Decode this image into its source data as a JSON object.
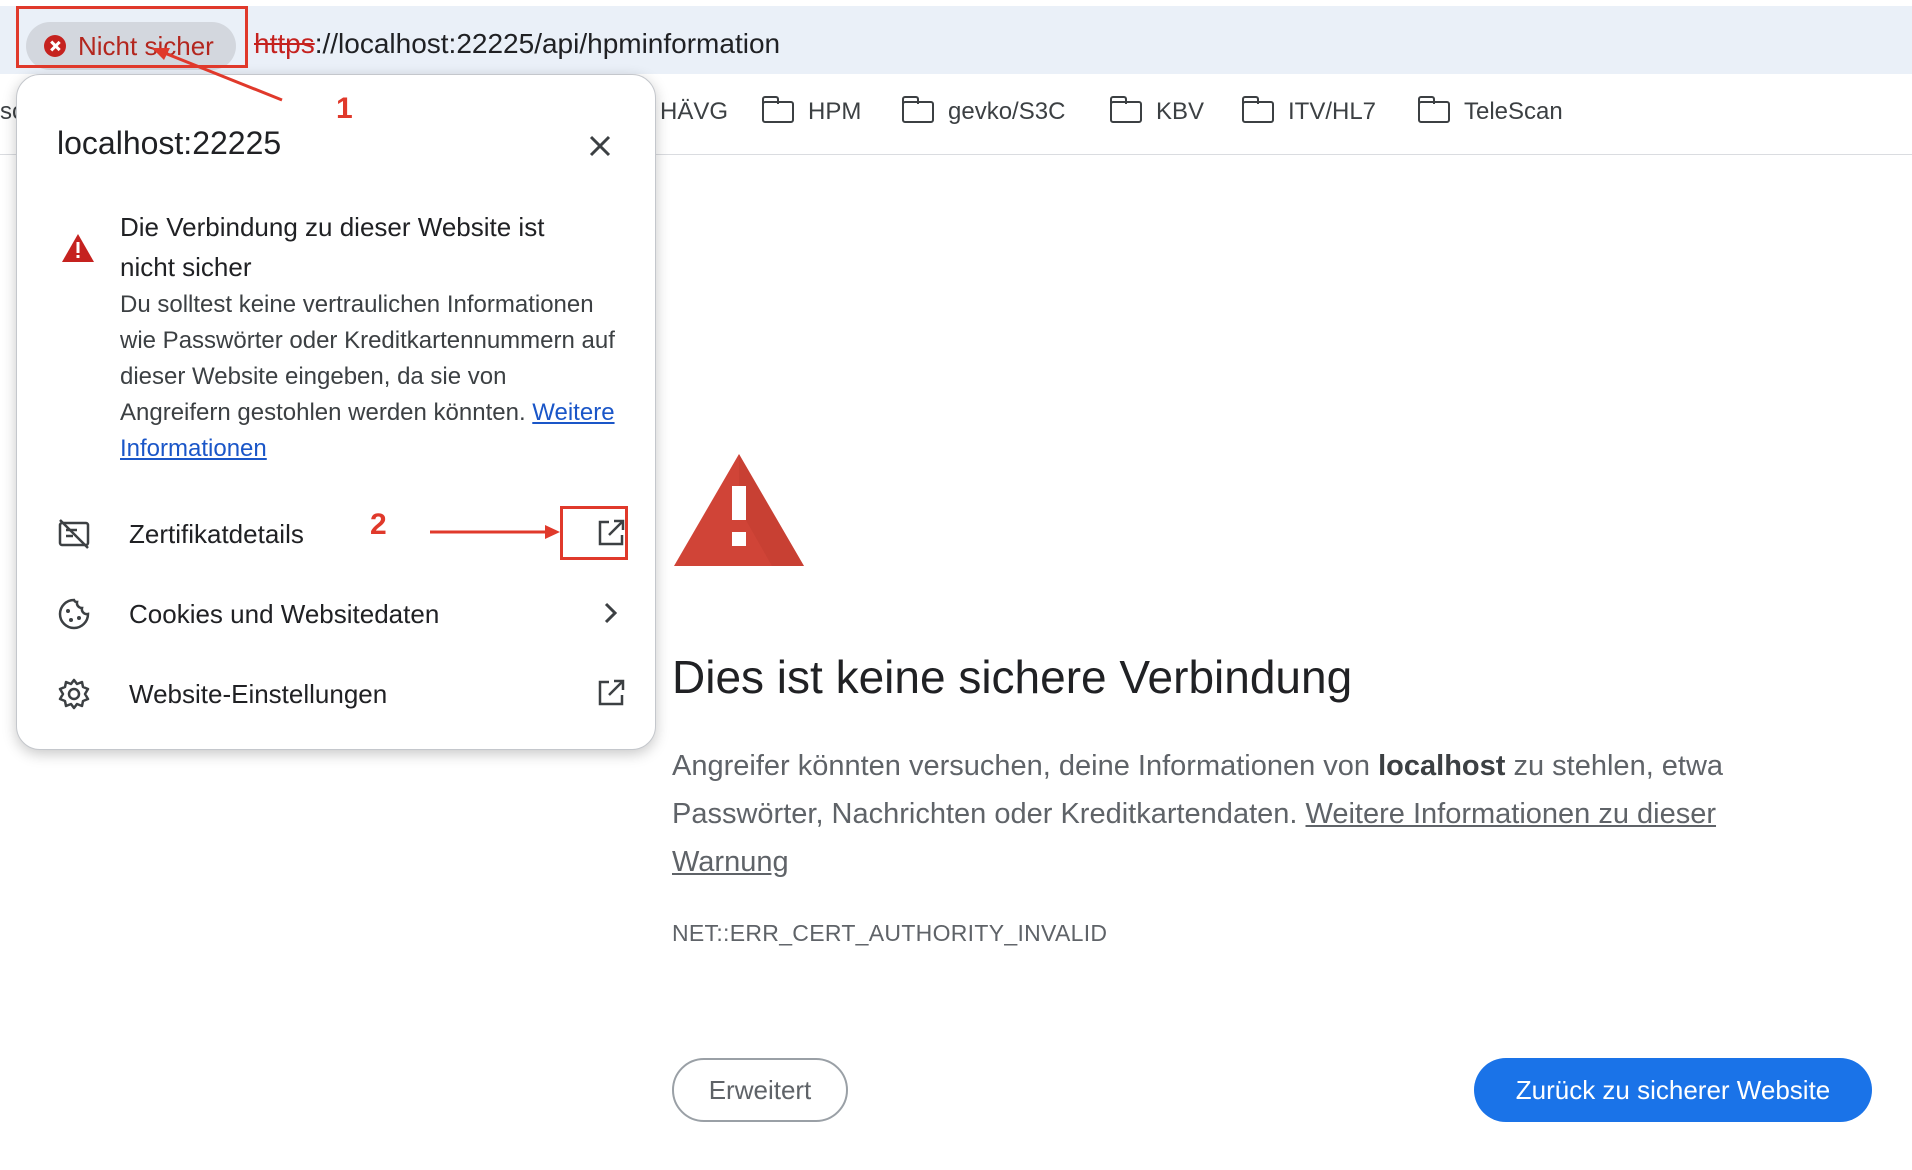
{
  "address_bar": {
    "security_chip_label": "Nicht sicher",
    "url_scheme": "https",
    "url_rest": "://localhost:22225/api/hpminformation"
  },
  "bookmarks": {
    "cut_text": "sc",
    "items": [
      {
        "label": "HÄVG",
        "has_folder": false
      },
      {
        "label": "HPM",
        "has_folder": true
      },
      {
        "label": "gevko/S3C",
        "has_folder": true
      },
      {
        "label": "KBV",
        "has_folder": true
      },
      {
        "label": "ITV/HL7",
        "has_folder": true
      },
      {
        "label": "TeleScan",
        "has_folder": true
      }
    ]
  },
  "popup": {
    "host": "localhost:22225",
    "heading": "Die Verbindung zu dieser Website ist nicht sicher",
    "body": "Du solltest keine vertraulichen Informationen wie Passwörter oder Kreditkartennummern auf dieser Website eingeben, da sie von Angreifern gestohlen werden könnten.",
    "more_info_link": "Weitere Informationen",
    "rows": {
      "certificate": "Zertifikatdetails",
      "cookies": "Cookies und Websitedaten",
      "settings": "Website-Einstellungen"
    }
  },
  "interstitial": {
    "title": "Dies ist keine sichere Verbindung",
    "desc_before": "Angreifer könnten versuchen, deine Informationen von ",
    "desc_host": "localhost",
    "desc_after": " zu stehlen, etwa Passwörter, Nachrichten oder Kreditkartendaten. ",
    "desc_link": "Weitere Informationen zu dieser Warnung",
    "error_code": "NET::ERR_CERT_AUTHORITY_INVALID",
    "advanced_button": "Erweitert",
    "back_button": "Zurück zu sicherer Website"
  },
  "annotations": {
    "step1": "1",
    "step2": "2",
    "color": "#e0392b"
  },
  "colors": {
    "warning_red": "#d04437",
    "primary_blue": "#1a73e8",
    "insecure_red": "#c5221f"
  }
}
